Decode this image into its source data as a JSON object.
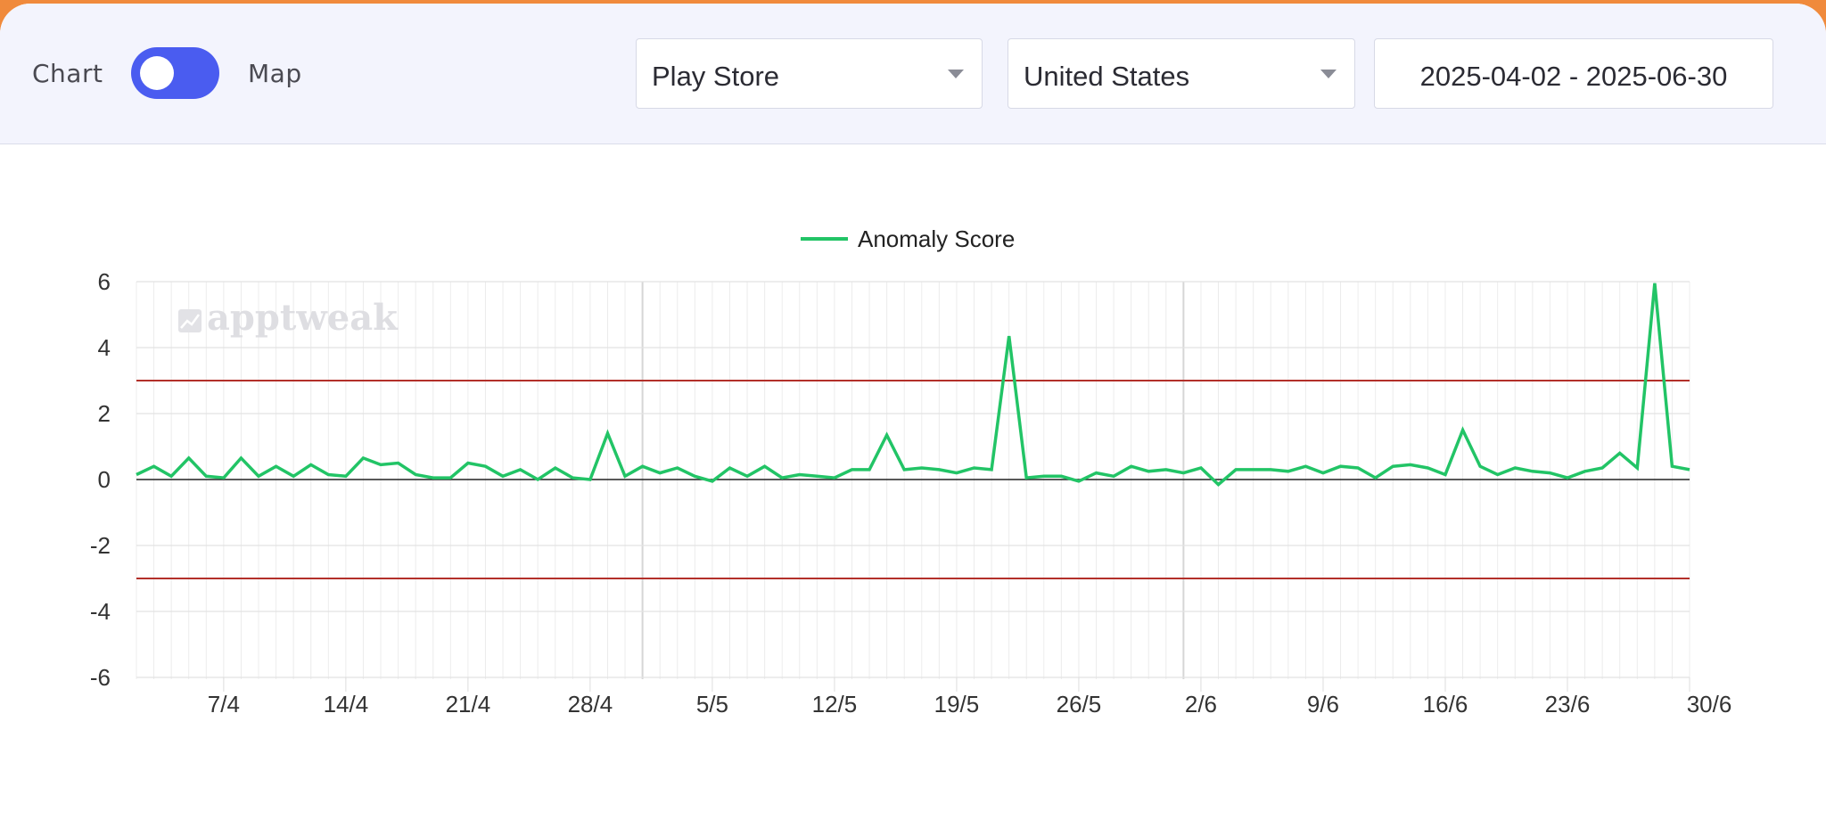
{
  "toolbar": {
    "view_toggle": {
      "left_label": "Chart",
      "right_label": "Map"
    },
    "store_select": {
      "value": "Play Store"
    },
    "country_select": {
      "value": "United States"
    },
    "date_range": "2025-04-02 - 2025-06-30"
  },
  "watermark": "apptweak",
  "colors": {
    "series": "#22c466",
    "threshold": "#b3302a",
    "toggle": "#4a5cf0",
    "accent_bar": "#f08a3c"
  },
  "chart_data": {
    "type": "line",
    "legend_position": "top-center",
    "grid": true,
    "ylim": [
      -6,
      6
    ],
    "yticks": [
      "6",
      "4",
      "2",
      "0",
      "-2",
      "-4",
      "-6"
    ],
    "ytick_values": [
      6,
      4,
      2,
      0,
      -2,
      -4,
      -6
    ],
    "xlim": [
      "2025-04-02",
      "2025-06-30"
    ],
    "xtick_labels": [
      "7/4",
      "14/4",
      "21/4",
      "28/4",
      "5/5",
      "12/5",
      "19/5",
      "26/5",
      "2/6",
      "9/6",
      "16/6",
      "23/6",
      "30/6"
    ],
    "xtick_dates": [
      "2025-04-07",
      "2025-04-14",
      "2025-04-21",
      "2025-04-28",
      "2025-05-05",
      "2025-05-12",
      "2025-05-19",
      "2025-05-26",
      "2025-06-02",
      "2025-06-09",
      "2025-06-16",
      "2025-06-23",
      "2025-06-30"
    ],
    "thresholds": [
      3,
      -3
    ],
    "series": [
      {
        "name": "Anomaly Score",
        "x": [
          "2025-04-02",
          "2025-04-03",
          "2025-04-04",
          "2025-04-05",
          "2025-04-06",
          "2025-04-07",
          "2025-04-08",
          "2025-04-09",
          "2025-04-10",
          "2025-04-11",
          "2025-04-12",
          "2025-04-13",
          "2025-04-14",
          "2025-04-15",
          "2025-04-16",
          "2025-04-17",
          "2025-04-18",
          "2025-04-19",
          "2025-04-20",
          "2025-04-21",
          "2025-04-22",
          "2025-04-23",
          "2025-04-24",
          "2025-04-25",
          "2025-04-26",
          "2025-04-27",
          "2025-04-28",
          "2025-04-29",
          "2025-04-30",
          "2025-05-01",
          "2025-05-02",
          "2025-05-03",
          "2025-05-04",
          "2025-05-05",
          "2025-05-06",
          "2025-05-07",
          "2025-05-08",
          "2025-05-09",
          "2025-05-10",
          "2025-05-11",
          "2025-05-12",
          "2025-05-13",
          "2025-05-14",
          "2025-05-15",
          "2025-05-16",
          "2025-05-17",
          "2025-05-18",
          "2025-05-19",
          "2025-05-20",
          "2025-05-21",
          "2025-05-22",
          "2025-05-23",
          "2025-05-24",
          "2025-05-25",
          "2025-05-26",
          "2025-05-27",
          "2025-05-28",
          "2025-05-29",
          "2025-05-30",
          "2025-05-31",
          "2025-06-01",
          "2025-06-02",
          "2025-06-03",
          "2025-06-04",
          "2025-06-05",
          "2025-06-06",
          "2025-06-07",
          "2025-06-08",
          "2025-06-09",
          "2025-06-10",
          "2025-06-11",
          "2025-06-12",
          "2025-06-13",
          "2025-06-14",
          "2025-06-15",
          "2025-06-16",
          "2025-06-17",
          "2025-06-18",
          "2025-06-19",
          "2025-06-20",
          "2025-06-21",
          "2025-06-22",
          "2025-06-23",
          "2025-06-24",
          "2025-06-25",
          "2025-06-26",
          "2025-06-27",
          "2025-06-28",
          "2025-06-29",
          "2025-06-30"
        ],
        "values": [
          0.15,
          0.4,
          0.1,
          0.65,
          0.1,
          0.05,
          0.65,
          0.1,
          0.4,
          0.1,
          0.45,
          0.15,
          0.1,
          0.65,
          0.45,
          0.5,
          0.15,
          0.05,
          0.05,
          0.5,
          0.4,
          0.1,
          0.3,
          0.0,
          0.35,
          0.05,
          0.0,
          1.4,
          0.1,
          0.4,
          0.2,
          0.35,
          0.1,
          -0.05,
          0.35,
          0.1,
          0.4,
          0.05,
          0.15,
          0.1,
          0.05,
          0.3,
          0.3,
          1.35,
          0.3,
          0.35,
          0.3,
          0.2,
          0.35,
          0.3,
          4.35,
          0.05,
          0.1,
          0.1,
          -0.05,
          0.2,
          0.1,
          0.4,
          0.25,
          0.3,
          0.2,
          0.35,
          -0.15,
          0.3,
          0.3,
          0.3,
          0.25,
          0.4,
          0.2,
          0.4,
          0.35,
          0.05,
          0.4,
          0.45,
          0.35,
          0.15,
          1.5,
          0.4,
          0.15,
          0.35,
          0.25,
          0.2,
          0.05,
          0.25,
          0.35,
          0.8,
          0.35,
          5.95,
          0.4,
          0.3
        ]
      }
    ]
  }
}
